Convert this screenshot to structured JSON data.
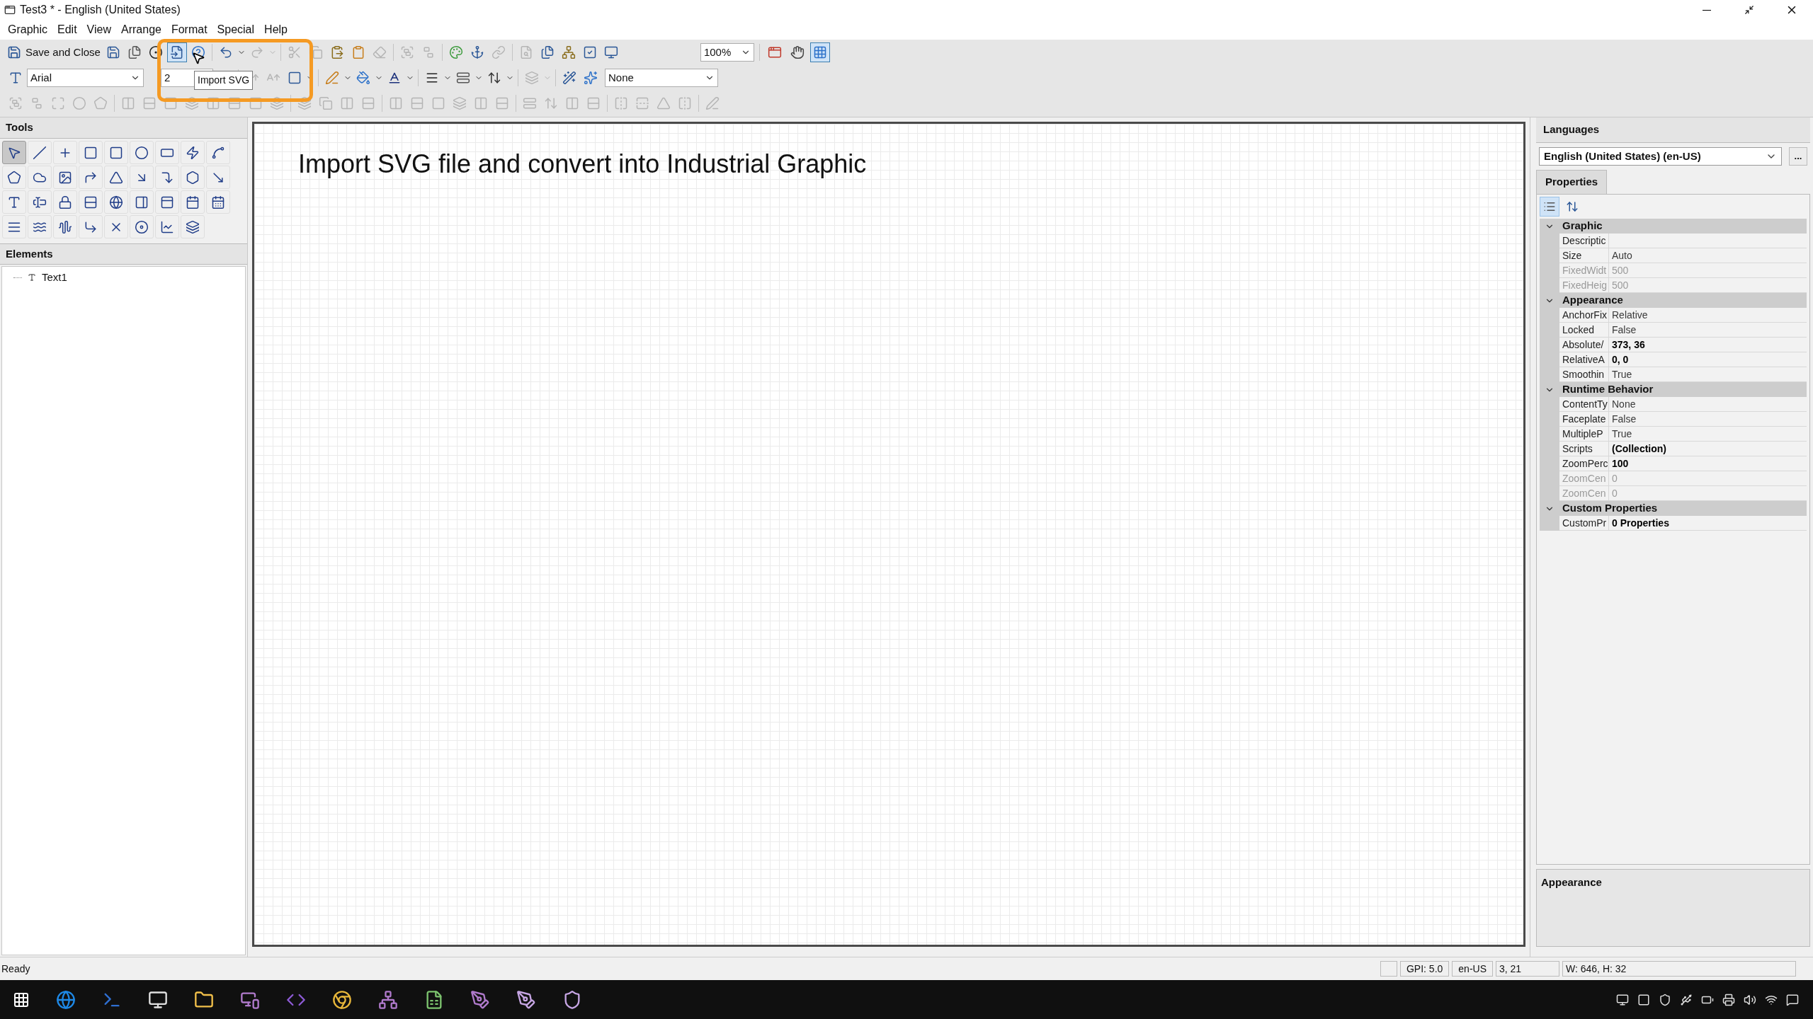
{
  "window": {
    "title": "Test3 * - English (United States)"
  },
  "menu": [
    "Graphic",
    "Edit",
    "View",
    "Arrange",
    "Format",
    "Special",
    "Help"
  ],
  "toolbar": {
    "save_label": "Save and Close",
    "zoom": "100%",
    "font": "Arial",
    "font_size": "2",
    "line_style": "None",
    "tooltip": "Import SVG"
  },
  "tools_panel": {
    "title": "Tools",
    "tools": [
      {
        "selected": true
      },
      {
        "selected": false
      },
      {
        "selected": false
      },
      {
        "selected": false
      },
      {
        "selected": false
      },
      {
        "selected": false
      },
      {
        "selected": false
      },
      {
        "selected": false
      },
      {
        "selected": false
      },
      {
        "selected": false
      },
      {
        "selected": false
      },
      {
        "selected": false
      },
      {
        "selected": false
      },
      {
        "selected": false
      },
      {
        "selected": false
      },
      {
        "selected": false
      },
      {
        "selected": false
      },
      {
        "selected": false
      },
      {
        "selected": false
      },
      {
        "selected": false
      },
      {
        "selected": false
      },
      {
        "selected": false
      },
      {
        "selected": false
      },
      {
        "selected": false
      },
      {
        "selected": false
      },
      {
        "selected": false
      },
      {
        "selected": false
      },
      {
        "selected": false
      },
      {
        "selected": false
      },
      {
        "selected": false
      },
      {
        "selected": false
      },
      {
        "selected": false
      },
      {
        "selected": false
      },
      {
        "selected": false
      },
      {
        "selected": false
      }
    ]
  },
  "elements_panel": {
    "title": "Elements",
    "items": [
      {
        "label": "Text1",
        "selected": false
      }
    ]
  },
  "canvas": {
    "text": "Import SVG file and convert into Industrial Graphic"
  },
  "languages": {
    "title": "Languages",
    "value": "English (United States) (en-US)",
    "more": "..."
  },
  "properties": {
    "tab": "Properties",
    "sort": [
      {
        "kind": "categorized",
        "selected": true
      },
      {
        "kind": "alphabetical",
        "selected": false
      }
    ],
    "groups": [
      {
        "name": "Graphic",
        "expanded": true,
        "rows": [
          {
            "name": "Descriptic",
            "disabled": false
          },
          {
            "name": "Size",
            "value": "Auto",
            "disabled": false,
            "modified": false
          },
          {
            "name": "FixedWidt",
            "value": "500",
            "disabled": true,
            "modified": false
          },
          {
            "name": "FixedHeig",
            "value": "500",
            "disabled": true,
            "modified": false
          }
        ]
      },
      {
        "name": "Appearance",
        "expanded": true,
        "rows": [
          {
            "name": "AnchorFix",
            "value": "Relative",
            "disabled": false,
            "modified": false
          },
          {
            "name": "Locked",
            "value": "False",
            "disabled": false,
            "modified": false
          },
          {
            "name": "Absolute/",
            "value": "373, 36",
            "disabled": false,
            "modified": true
          },
          {
            "name": "RelativeA",
            "value": "0, 0",
            "disabled": false,
            "modified": true
          },
          {
            "name": "Smoothin",
            "value": "True",
            "disabled": false,
            "modified": false
          }
        ]
      },
      {
        "name": "Runtime Behavior",
        "expanded": true,
        "rows": [
          {
            "name": "ContentTy",
            "value": "None",
            "disabled": false,
            "modified": false
          },
          {
            "name": "Faceplate",
            "value": "False",
            "disabled": false,
            "modified": false
          },
          {
            "name": "MultipleP",
            "value": "True",
            "disabled": false,
            "modified": false
          },
          {
            "name": "Scripts",
            "value": "(Collection)",
            "disabled": false,
            "modified": true
          },
          {
            "name": "ZoomPerc",
            "value": "100",
            "disabled": false,
            "modified": true
          },
          {
            "name": "ZoomCen",
            "value": "0",
            "disabled": true,
            "modified": false
          },
          {
            "name": "ZoomCen",
            "value": "0",
            "disabled": true,
            "modified": false
          }
        ]
      },
      {
        "name": "Custom Properties",
        "expanded": true,
        "rows": [
          {
            "name": "CustomPr",
            "value": "0 Properties",
            "disabled": false,
            "modified": true
          }
        ]
      }
    ],
    "description_title": "Appearance"
  },
  "status_bar": {
    "message": "Ready",
    "gpi": "GPI: 5.0",
    "locale": "en-US",
    "position": "3, 21",
    "size": "W: 646, H: 32"
  }
}
